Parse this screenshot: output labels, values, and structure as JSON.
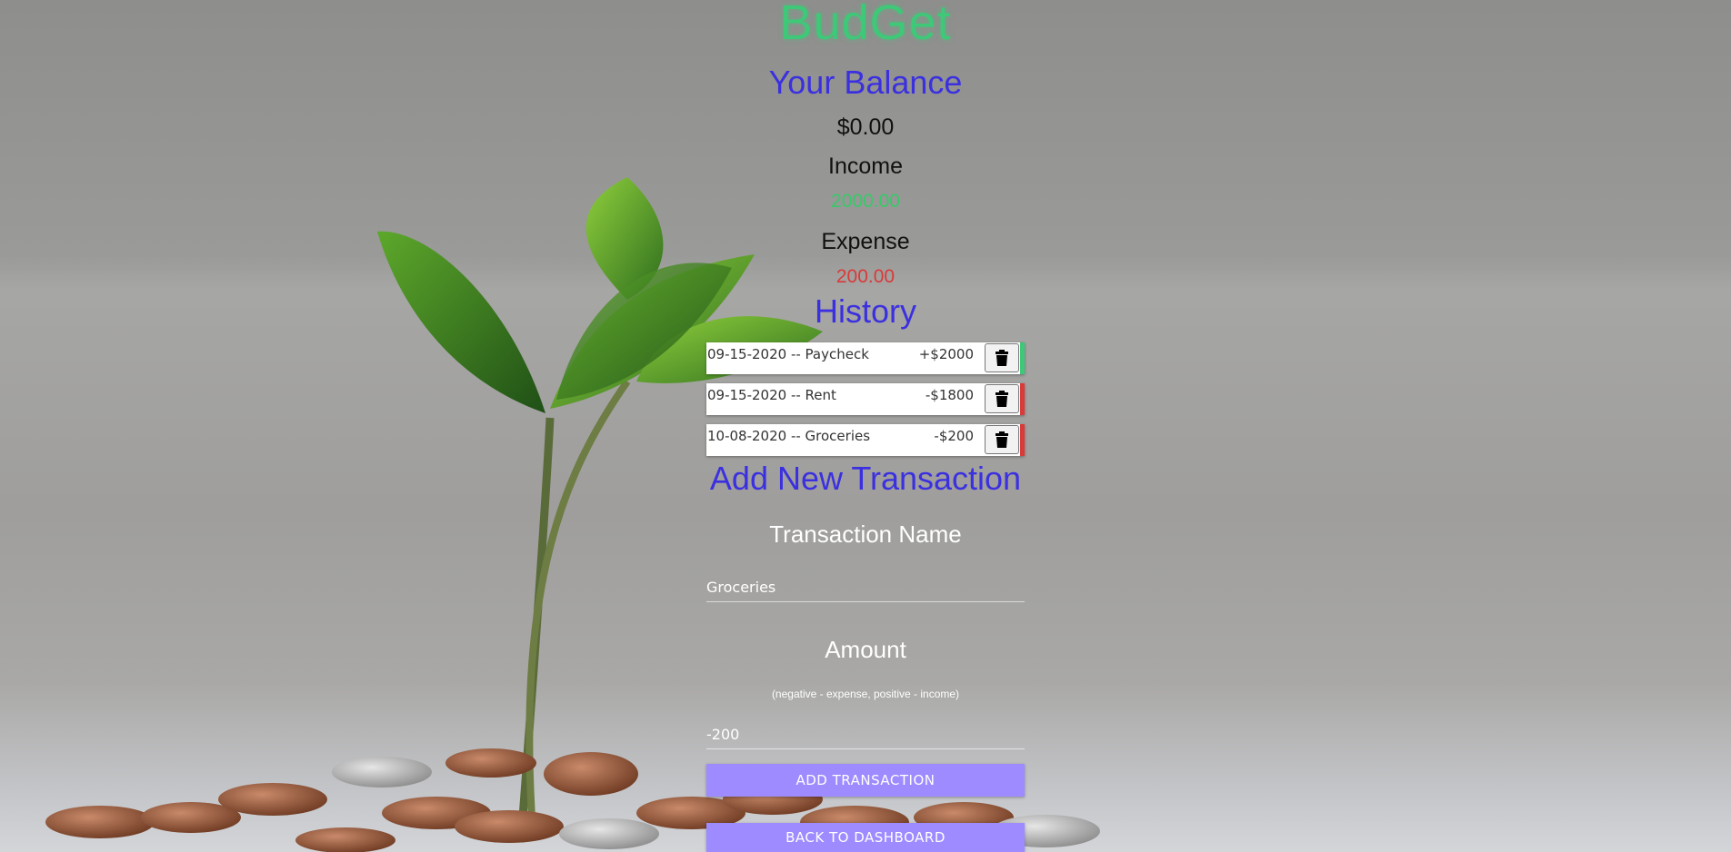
{
  "app": {
    "title": "BudGet"
  },
  "balance": {
    "label": "Your Balance",
    "value": "$0.00"
  },
  "income": {
    "label": "Income",
    "value": "2000.00",
    "color": "#37c96a"
  },
  "expense": {
    "label": "Expense",
    "value": "200.00",
    "color": "#d93a3a"
  },
  "history": {
    "label": "History",
    "items": [
      {
        "name": "09-15-2020 -- Paycheck",
        "amount": "+$2000",
        "type": "income"
      },
      {
        "name": "09-15-2020 -- Rent",
        "amount": "-$1800",
        "type": "expense"
      },
      {
        "name": "10-08-2020 -- Groceries",
        "amount": "-$200",
        "type": "expense"
      }
    ]
  },
  "form": {
    "title": "Add New Transaction",
    "name_label": "Transaction Name",
    "name_value": "Groceries",
    "amount_label": "Amount",
    "amount_hint": "(negative - expense, positive - income)",
    "amount_value": "-200",
    "add_button": "ADD TRANSACTION",
    "back_button": "BACK TO DASHBOARD"
  },
  "icons": {
    "delete": "trash-icon"
  },
  "colors": {
    "accent_button": "#9d8bff",
    "heading": "#3b30e0",
    "brand": "#3ec878"
  }
}
